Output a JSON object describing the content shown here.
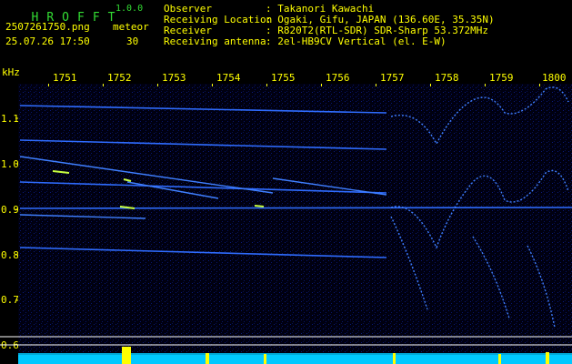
{
  "header": {
    "app_letters": [
      "H",
      "R",
      "O",
      "F",
      "F",
      "T"
    ],
    "version": "1.0.0",
    "filename": "2507261750.png",
    "datetime": "25.07.26 17:50",
    "counter_label": "meteor",
    "counter_value": "30",
    "info": [
      {
        "key": "Observer",
        "value": ": Takanori Kawachi"
      },
      {
        "key": "Receiving Location",
        "value": ": Ogaki, Gifu, JAPAN (136.60E, 35.35N)"
      },
      {
        "key": "Receiver",
        "value": ": R820T2(RTL-SDR) SDR-Sharp 53.372MHz"
      },
      {
        "key": "Receiving antenna",
        "value": ": 2el-HB9CV Vertical (el. E-W)"
      }
    ]
  },
  "axes": {
    "y_unit": "kHz",
    "y_ticks": [
      "1.1",
      "1.0",
      "0.9",
      "0.8",
      "0.7",
      "0.6"
    ],
    "x_ticks": [
      "1751",
      "1752",
      "1753",
      "1754",
      "1755",
      "1756",
      "1757",
      "1758",
      "1759",
      "1800"
    ]
  },
  "colors": {
    "background": "#000000",
    "text_green": "#33dd33",
    "text_yellow": "#ffff00",
    "trace_blue": "#2b6bff",
    "noise_bar": "#00c8ff"
  }
}
